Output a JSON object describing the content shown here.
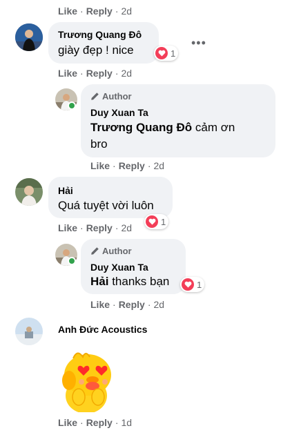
{
  "actions": {
    "like": "Like",
    "reply": "Reply",
    "sep": "·"
  },
  "top_actions": {
    "time": "2d"
  },
  "comment1": {
    "author": "Trương Quang Đô",
    "text": "giày đẹp ! nice",
    "reactions": "1",
    "time": "2d"
  },
  "reply1": {
    "badge": "Author",
    "author": "Duy Xuan Ta",
    "mention": "Trương Quang Đô",
    "text_line1": " cảm ơn",
    "text_line2": "bro",
    "time": "2d"
  },
  "comment2": {
    "author": "Hải",
    "text": "Quá tuyệt vời luôn",
    "reactions": "1",
    "time": "2d"
  },
  "reply2": {
    "badge": "Author",
    "author": "Duy Xuan Ta",
    "mention": "Hải",
    "text": " thanks bạn",
    "reactions": "1",
    "time": "2d"
  },
  "comment3": {
    "author": "Anh Đức Acoustics",
    "sticker": "yellow-chick-heart-eyes",
    "time": "1d"
  },
  "colors": {
    "bubble": "#f0f2f5",
    "meta": "#65676b",
    "heart": "#f33e58",
    "online": "#31a24c"
  }
}
